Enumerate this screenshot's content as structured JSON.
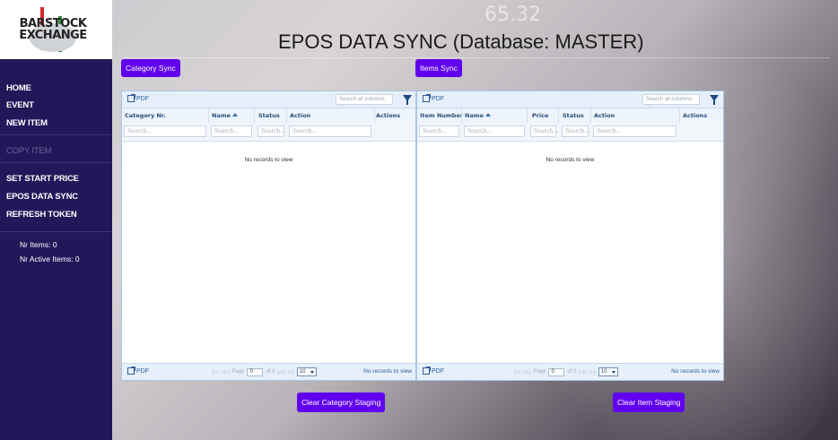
{
  "brand": {
    "logo_line1": "BARSTOCK",
    "logo_line2": "EXCHANGE"
  },
  "background": {
    "ticker_value": "65.32"
  },
  "page": {
    "title": "EPOS DATA SYNC (Database: MASTER)"
  },
  "sidebar": {
    "items": [
      {
        "label": "HOME"
      },
      {
        "label": "EVENT"
      },
      {
        "label": "NEW ITEM"
      },
      {
        "label": "COPY ITEM",
        "disabled": true
      },
      {
        "label": "SET START PRICE"
      },
      {
        "label": "EPOS DATA SYNC"
      },
      {
        "label": "REFRESH TOKEN"
      }
    ],
    "stats": {
      "nr_items": "Nr Items: 0",
      "nr_active_items": "Nr Active Items: 0"
    }
  },
  "category_panel": {
    "sync_button": "Category Sync",
    "pdf_label": "PDF",
    "search_all_placeholder": "Search all columns ...",
    "columns": [
      "Category Nr.",
      "Name",
      "Status",
      "Action",
      "Actions"
    ],
    "filter_placeholder": "Search...",
    "empty_message": "No records to view",
    "pager": {
      "page_label": "Page",
      "page_value": "0",
      "of_label": "of 0",
      "page_size": "10"
    },
    "status": "No records to view",
    "clear_button": "Clear Category Staging"
  },
  "items_panel": {
    "sync_button": "Items Sync",
    "pdf_label": "PDF",
    "search_all_placeholder": "Search all columns ...",
    "columns": [
      "Item Number",
      "Name",
      "Price",
      "Status",
      "Action",
      "Actions"
    ],
    "filter_placeholder": "Search...",
    "empty_message": "No records to view",
    "pager": {
      "page_label": "Page",
      "page_value": "0",
      "of_label": "of 0",
      "page_size": "10"
    },
    "status": "No records to view",
    "clear_button": "Clear Item Staging"
  },
  "colors": {
    "sidebar_bg": "#21185a",
    "accent": "#6100ee",
    "grid_border": "#a8c6e6"
  }
}
